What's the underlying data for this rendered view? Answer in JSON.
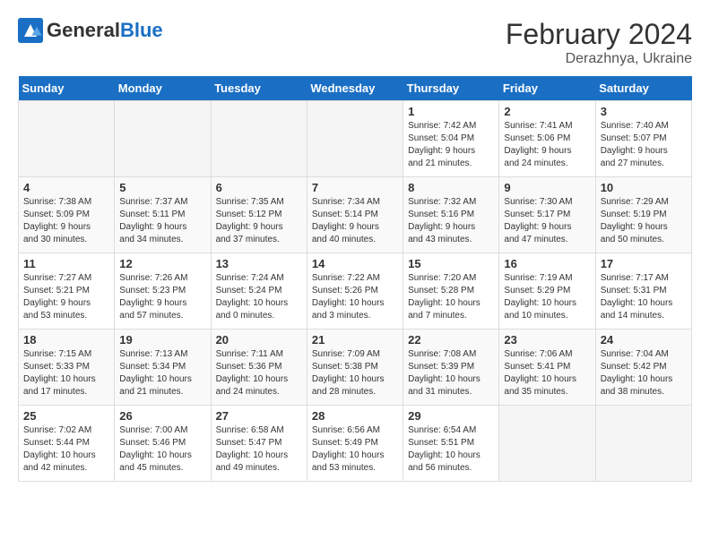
{
  "header": {
    "logo_general": "General",
    "logo_blue": "Blue",
    "month_year": "February 2024",
    "location": "Derazhnya, Ukraine"
  },
  "weekdays": [
    "Sunday",
    "Monday",
    "Tuesday",
    "Wednesday",
    "Thursday",
    "Friday",
    "Saturday"
  ],
  "weeks": [
    [
      {
        "day": "",
        "info": ""
      },
      {
        "day": "",
        "info": ""
      },
      {
        "day": "",
        "info": ""
      },
      {
        "day": "",
        "info": ""
      },
      {
        "day": "1",
        "info": "Sunrise: 7:42 AM\nSunset: 5:04 PM\nDaylight: 9 hours\nand 21 minutes."
      },
      {
        "day": "2",
        "info": "Sunrise: 7:41 AM\nSunset: 5:06 PM\nDaylight: 9 hours\nand 24 minutes."
      },
      {
        "day": "3",
        "info": "Sunrise: 7:40 AM\nSunset: 5:07 PM\nDaylight: 9 hours\nand 27 minutes."
      }
    ],
    [
      {
        "day": "4",
        "info": "Sunrise: 7:38 AM\nSunset: 5:09 PM\nDaylight: 9 hours\nand 30 minutes."
      },
      {
        "day": "5",
        "info": "Sunrise: 7:37 AM\nSunset: 5:11 PM\nDaylight: 9 hours\nand 34 minutes."
      },
      {
        "day": "6",
        "info": "Sunrise: 7:35 AM\nSunset: 5:12 PM\nDaylight: 9 hours\nand 37 minutes."
      },
      {
        "day": "7",
        "info": "Sunrise: 7:34 AM\nSunset: 5:14 PM\nDaylight: 9 hours\nand 40 minutes."
      },
      {
        "day": "8",
        "info": "Sunrise: 7:32 AM\nSunset: 5:16 PM\nDaylight: 9 hours\nand 43 minutes."
      },
      {
        "day": "9",
        "info": "Sunrise: 7:30 AM\nSunset: 5:17 PM\nDaylight: 9 hours\nand 47 minutes."
      },
      {
        "day": "10",
        "info": "Sunrise: 7:29 AM\nSunset: 5:19 PM\nDaylight: 9 hours\nand 50 minutes."
      }
    ],
    [
      {
        "day": "11",
        "info": "Sunrise: 7:27 AM\nSunset: 5:21 PM\nDaylight: 9 hours\nand 53 minutes."
      },
      {
        "day": "12",
        "info": "Sunrise: 7:26 AM\nSunset: 5:23 PM\nDaylight: 9 hours\nand 57 minutes."
      },
      {
        "day": "13",
        "info": "Sunrise: 7:24 AM\nSunset: 5:24 PM\nDaylight: 10 hours\nand 0 minutes."
      },
      {
        "day": "14",
        "info": "Sunrise: 7:22 AM\nSunset: 5:26 PM\nDaylight: 10 hours\nand 3 minutes."
      },
      {
        "day": "15",
        "info": "Sunrise: 7:20 AM\nSunset: 5:28 PM\nDaylight: 10 hours\nand 7 minutes."
      },
      {
        "day": "16",
        "info": "Sunrise: 7:19 AM\nSunset: 5:29 PM\nDaylight: 10 hours\nand 10 minutes."
      },
      {
        "day": "17",
        "info": "Sunrise: 7:17 AM\nSunset: 5:31 PM\nDaylight: 10 hours\nand 14 minutes."
      }
    ],
    [
      {
        "day": "18",
        "info": "Sunrise: 7:15 AM\nSunset: 5:33 PM\nDaylight: 10 hours\nand 17 minutes."
      },
      {
        "day": "19",
        "info": "Sunrise: 7:13 AM\nSunset: 5:34 PM\nDaylight: 10 hours\nand 21 minutes."
      },
      {
        "day": "20",
        "info": "Sunrise: 7:11 AM\nSunset: 5:36 PM\nDaylight: 10 hours\nand 24 minutes."
      },
      {
        "day": "21",
        "info": "Sunrise: 7:09 AM\nSunset: 5:38 PM\nDaylight: 10 hours\nand 28 minutes."
      },
      {
        "day": "22",
        "info": "Sunrise: 7:08 AM\nSunset: 5:39 PM\nDaylight: 10 hours\nand 31 minutes."
      },
      {
        "day": "23",
        "info": "Sunrise: 7:06 AM\nSunset: 5:41 PM\nDaylight: 10 hours\nand 35 minutes."
      },
      {
        "day": "24",
        "info": "Sunrise: 7:04 AM\nSunset: 5:42 PM\nDaylight: 10 hours\nand 38 minutes."
      }
    ],
    [
      {
        "day": "25",
        "info": "Sunrise: 7:02 AM\nSunset: 5:44 PM\nDaylight: 10 hours\nand 42 minutes."
      },
      {
        "day": "26",
        "info": "Sunrise: 7:00 AM\nSunset: 5:46 PM\nDaylight: 10 hours\nand 45 minutes."
      },
      {
        "day": "27",
        "info": "Sunrise: 6:58 AM\nSunset: 5:47 PM\nDaylight: 10 hours\nand 49 minutes."
      },
      {
        "day": "28",
        "info": "Sunrise: 6:56 AM\nSunset: 5:49 PM\nDaylight: 10 hours\nand 53 minutes."
      },
      {
        "day": "29",
        "info": "Sunrise: 6:54 AM\nSunset: 5:51 PM\nDaylight: 10 hours\nand 56 minutes."
      },
      {
        "day": "",
        "info": ""
      },
      {
        "day": "",
        "info": ""
      }
    ]
  ]
}
